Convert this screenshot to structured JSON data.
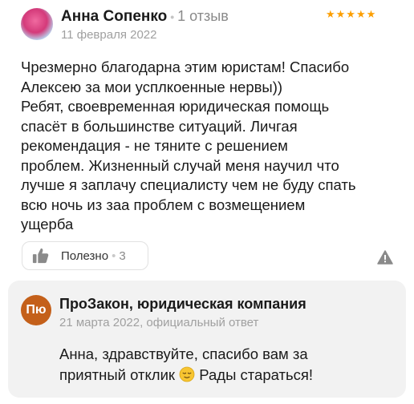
{
  "review": {
    "author": "Анна Сопенко",
    "reviews_count": "1 отзыв",
    "date": "11 февраля 2022",
    "rating": 5,
    "stars": "★★★★★",
    "text_lines": [
      "Чрезмерно благодарна этим юристам! Спасибо",
      "Алексею за мои усплкоенные нервы))",
      "Ребят, своевременная юридическая помощь",
      "спасёт в большинстве ситуаций. Личгая",
      "рекомендация - не тяните с решением",
      "проблем. Жизненный случай меня научил что",
      "лучше я заплачу специалисту чем не буду спать",
      "всю ночь из заа проблем с возмещением",
      "ущерба"
    ],
    "helpful_label": "Полезно",
    "helpful_count": "3"
  },
  "reply": {
    "avatar_initials": "Пю",
    "author": "ПроЗакон, юридическая компания",
    "meta": "21 марта 2022, официальный ответ",
    "line1": "Анна, здравствуйте, спасибо вам за",
    "line2_before": "приятный отклик",
    "line2_after": "Рады стараться!"
  },
  "colors": {
    "star": "#fc9e00",
    "reply_avatar": "#c4601a",
    "reply_bg": "#f2f2f2"
  },
  "icons": [
    "thumb-up-icon",
    "report-warning-icon",
    "relieved-face-emoji"
  ]
}
